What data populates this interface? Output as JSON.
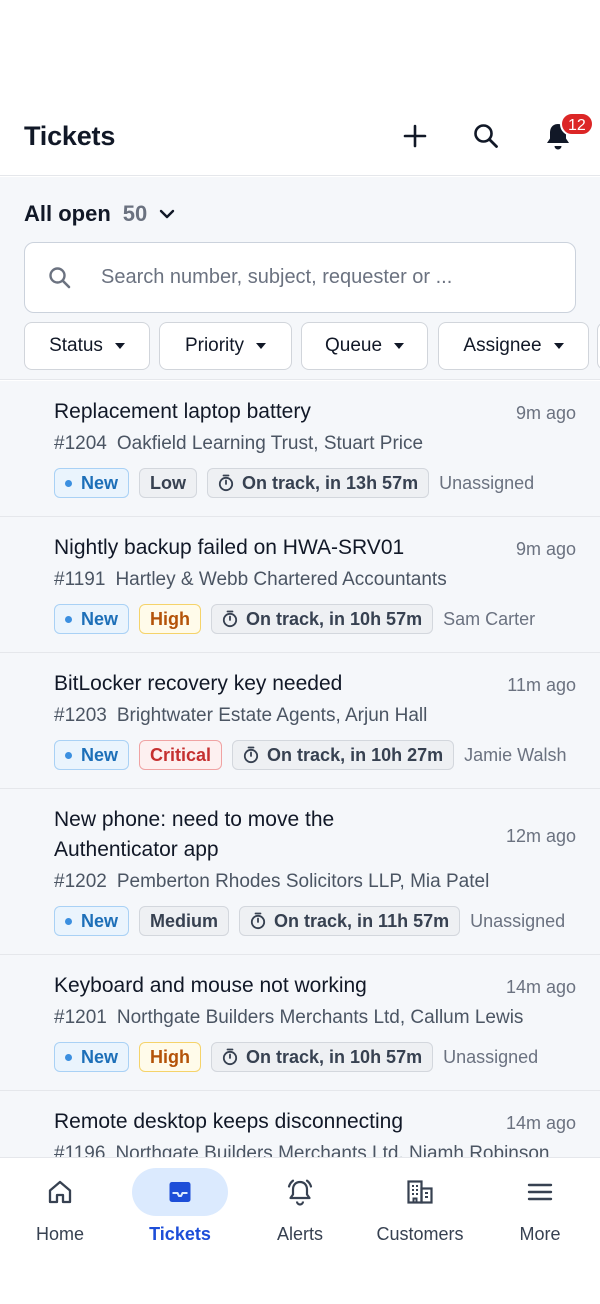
{
  "header": {
    "title": "Tickets",
    "notification_count": "12"
  },
  "view": {
    "title": "All open",
    "count": "50"
  },
  "search": {
    "placeholder": "Search number, subject, requester or ..."
  },
  "filters": [
    {
      "label": "Status"
    },
    {
      "label": "Priority"
    },
    {
      "label": "Queue"
    },
    {
      "label": "Assignee"
    }
  ],
  "tickets": [
    {
      "subject": "Replacement laptop battery",
      "time": "9m ago",
      "number": "#1204",
      "requester": "Oakfield Learning Trust, Stuart Price",
      "status": "New",
      "priority": "Low",
      "sla": "On track, in 13h 57m",
      "assignee": "Unassigned"
    },
    {
      "subject": "Nightly backup failed on HWA-SRV01",
      "time": "9m ago",
      "number": "#1191",
      "requester": "Hartley & Webb Chartered Accountants",
      "status": "New",
      "priority": "High",
      "sla": "On track, in 10h 57m",
      "assignee": "Sam Carter"
    },
    {
      "subject": "BitLocker recovery key needed",
      "time": "11m ago",
      "number": "#1203",
      "requester": "Brightwater Estate Agents, Arjun Hall",
      "status": "New",
      "priority": "Critical",
      "sla": "On track, in 10h 27m",
      "assignee": "Jamie Walsh"
    },
    {
      "subject_line1": "New phone: need to move the",
      "subject_line2": "Authenticator app",
      "time": "12m ago",
      "number": "#1202",
      "requester": "Pemberton Rhodes Solicitors LLP, Mia Patel",
      "status": "New",
      "priority": "Medium",
      "sla": "On track, in 11h 57m",
      "assignee": "Unassigned"
    },
    {
      "subject": "Keyboard and mouse not working",
      "time": "14m ago",
      "number": "#1201",
      "requester": "Northgate Builders Merchants Ltd, Callum Lewis",
      "status": "New",
      "priority": "High",
      "sla": "On track, in 10h 57m",
      "assignee": "Unassigned"
    },
    {
      "subject": "Remote desktop keeps disconnecting",
      "time": "14m ago",
      "number": "#1196",
      "requester": "Northgate Builders Merchants Ltd, Niamh Robinson"
    }
  ],
  "nav": [
    {
      "label": "Home",
      "icon": "home-icon"
    },
    {
      "label": "Tickets",
      "icon": "inbox-icon",
      "active": true
    },
    {
      "label": "Alerts",
      "icon": "bell-ringing-icon"
    },
    {
      "label": "Customers",
      "icon": "building-icon"
    },
    {
      "label": "More",
      "icon": "menu-icon"
    }
  ],
  "colors": {
    "accent": "#1d4ed8",
    "badge": "#dc2626",
    "background": "#f5f7fa"
  }
}
